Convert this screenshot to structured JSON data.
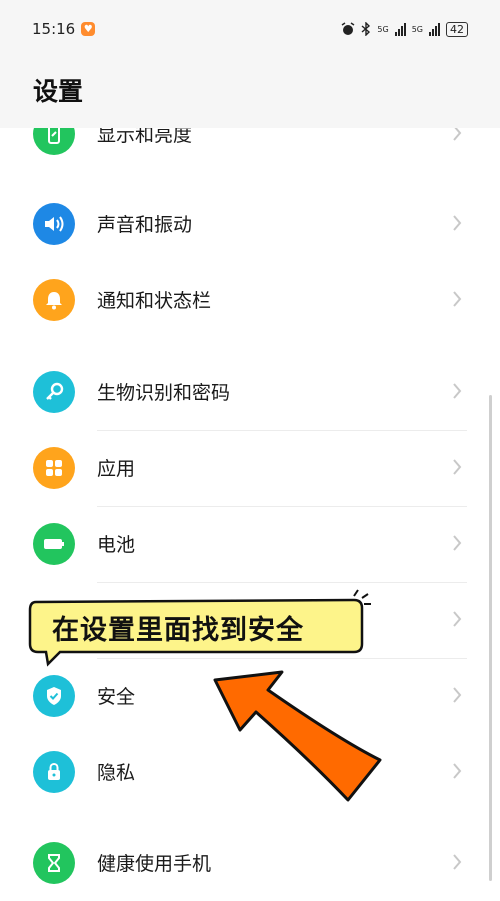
{
  "status_bar": {
    "time": "15:16",
    "sig1": "5G",
    "sig2": "5G",
    "battery": "42"
  },
  "header": {
    "title": "设置"
  },
  "items": [
    {
      "label": "显示和亮度",
      "icon": "display-icon",
      "color": "#22c55e"
    },
    {
      "label": "声音和振动",
      "icon": "speaker-icon",
      "color": "#1e88e5"
    },
    {
      "label": "通知和状态栏",
      "icon": "bell-icon",
      "color": "#ffa41c"
    },
    {
      "label": "生物识别和密码",
      "icon": "key-icon",
      "color": "#1ec0d8"
    },
    {
      "label": "应用",
      "icon": "apps-icon",
      "color": "#ffa41c"
    },
    {
      "label": "电池",
      "icon": "battery-icon",
      "color": "#22c55e"
    },
    {
      "label": "",
      "icon": "",
      "color": "#22c55e"
    },
    {
      "label": "安全",
      "icon": "shield-icon",
      "color": "#1ec0d8"
    },
    {
      "label": "隐私",
      "icon": "lock-icon",
      "color": "#1ec0d8"
    },
    {
      "label": "健康使用手机",
      "icon": "hourglass-icon",
      "color": "#22c55e"
    }
  ],
  "annotation": {
    "text": "在设置里面找到安全",
    "bubble_color": "#fdf48a",
    "arrow_color": "#ff6a00"
  }
}
